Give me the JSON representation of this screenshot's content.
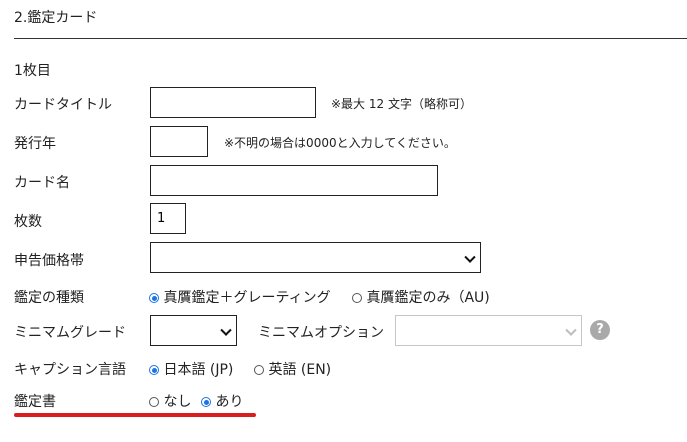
{
  "section": {
    "title": "2.鑑定カード"
  },
  "card": {
    "count_label": "1枚目",
    "card_title": {
      "label": "カードタイトル",
      "value": "",
      "note": "※最大 12 文字（略称可）"
    },
    "issue_year": {
      "label": "発行年",
      "value": "",
      "note": "※不明の場合は0000と入力してください。"
    },
    "card_name": {
      "label": "カード名",
      "value": ""
    },
    "quantity": {
      "label": "枚数",
      "value": "1"
    },
    "declared_price": {
      "label": "申告価格帯",
      "value": ""
    },
    "appraisal_type": {
      "label": "鑑定の種類",
      "options": [
        "真贋鑑定＋グレーティング",
        "真贋鑑定のみ（AU)"
      ],
      "selected": 0
    },
    "minimum_grade": {
      "label": "ミニマムグレード",
      "value": ""
    },
    "minimum_option": {
      "label": "ミニマムオプション",
      "value": "",
      "help": "?"
    },
    "caption_language": {
      "label": "キャプション言語",
      "options": [
        "日本語 (JP)",
        "英語 (EN)"
      ],
      "selected": 0
    },
    "certificate": {
      "label": "鑑定書",
      "options": [
        "なし",
        "あり"
      ],
      "selected": 1
    }
  },
  "colors": {
    "accent": "#1a73e8",
    "highlight_underline": "#d81e1e",
    "help_badge": "#a9a9a9"
  }
}
